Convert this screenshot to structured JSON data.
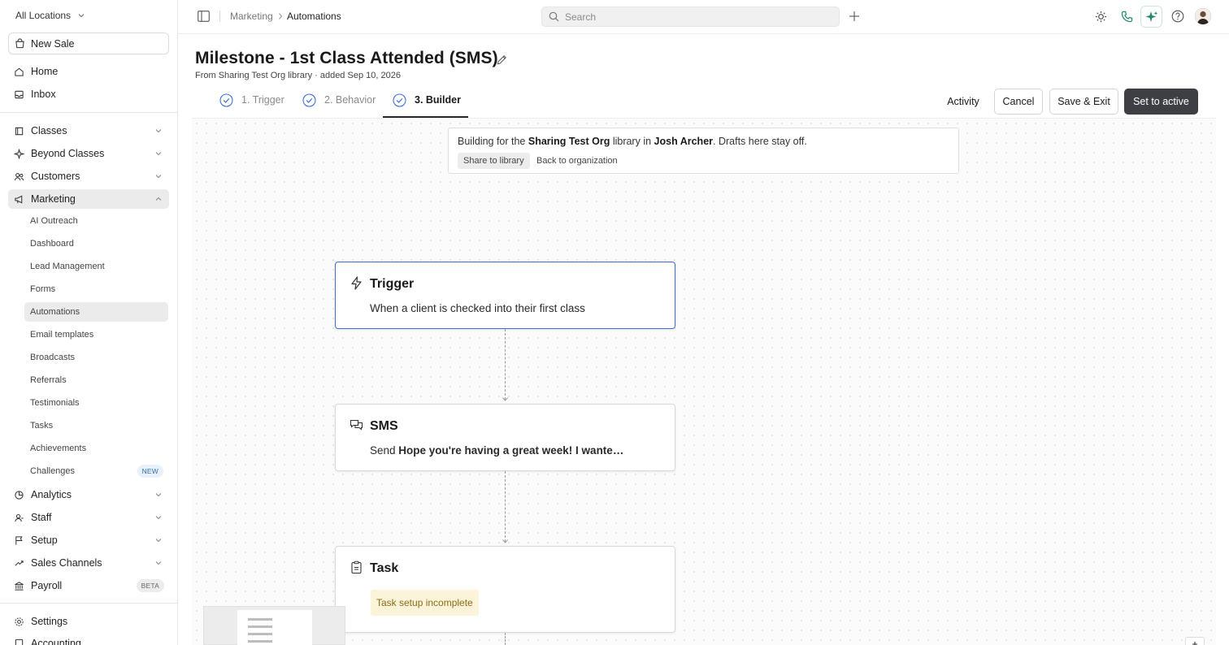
{
  "sidebar": {
    "location": "All Locations",
    "new_sale": "New Sale",
    "home": "Home",
    "inbox": "Inbox",
    "classes": "Classes",
    "beyond_classes": "Beyond Classes",
    "customers": "Customers",
    "marketing": "Marketing",
    "marketing_items": [
      "AI Outreach",
      "Dashboard",
      "Lead Management",
      "Forms",
      "Automations",
      "Email templates",
      "Broadcasts",
      "Referrals",
      "Testimonials",
      "Tasks",
      "Achievements",
      "Challenges"
    ],
    "challenges_badge": "NEW",
    "analytics": "Analytics",
    "staff": "Staff",
    "setup": "Setup",
    "sales_channels": "Sales Channels",
    "payroll": "Payroll",
    "payroll_badge": "BETA",
    "settings": "Settings",
    "accounting": "Accounting"
  },
  "topbar": {
    "breadcrumb_parent": "Marketing",
    "breadcrumb_current": "Automations",
    "search_placeholder": "Search"
  },
  "header": {
    "title": "Milestone - 1st Class Attended (SMS)",
    "subtitle": "From Sharing Test Org library · added Sep 10, 2026",
    "steps": [
      "1. Trigger",
      "2. Behavior",
      "3. Builder"
    ],
    "activity": "Activity",
    "cancel": "Cancel",
    "save_exit": "Save & Exit",
    "set_active": "Set to active"
  },
  "banner": {
    "text_pre": "Building for the ",
    "org": "Sharing Test Org",
    "text_mid": " library in ",
    "person": "Josh Archer",
    "text_post": ". Drafts here stay off.",
    "share_btn": "Share to library",
    "back_btn": "Back to organization"
  },
  "nodes": {
    "trigger": {
      "title": "Trigger",
      "desc": "When a client is checked into their first class"
    },
    "sms": {
      "title": "SMS",
      "desc_pre": "Send ",
      "desc_bold": "Hope you're having a great week! I wante…"
    },
    "task": {
      "title": "Task",
      "warning": "Task setup incomplete"
    }
  },
  "colors": {
    "accent": "#3b6fd8",
    "dark_button": "#3d3f44",
    "warning_bg": "#fbf4d9",
    "warning_text": "#8a6d1a",
    "phone_green": "#1f8a6a"
  }
}
